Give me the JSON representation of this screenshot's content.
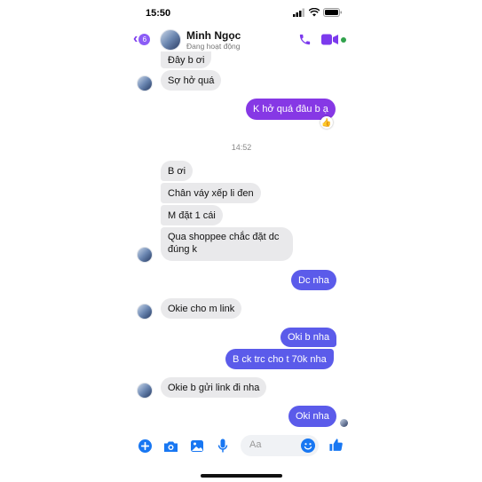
{
  "status_bar": {
    "time": "15:50"
  },
  "header": {
    "back_badge": "6",
    "contact_name": "Minh Ngọc",
    "status": "Đang hoạt động"
  },
  "messages": [
    {
      "text": "Đây b ơi",
      "sender": "contact"
    },
    {
      "text": "Sợ hở quá",
      "sender": "contact"
    },
    {
      "text": "K hở quá đâu b ạ",
      "sender": "me",
      "reaction": "like-icon"
    },
    {
      "text": "B ơi",
      "sender": "contact"
    },
    {
      "text": "Chân váy xếp li đen",
      "sender": "contact"
    },
    {
      "text": "M đặt 1 cái",
      "sender": "contact"
    },
    {
      "text": "Qua shoppee chắc đặt dc đúng k",
      "sender": "contact"
    },
    {
      "text": "Dc nha",
      "sender": "me"
    },
    {
      "text": "Okie cho m link",
      "sender": "contact"
    },
    {
      "text": "Oki b nha",
      "sender": "me"
    },
    {
      "text": "B ck trc cho t 70k nha",
      "sender": "me"
    },
    {
      "text": "Okie b gửi link đi nha",
      "sender": "contact"
    },
    {
      "text": "Oki nha",
      "sender": "me"
    }
  ],
  "timestamp": "14:52",
  "composer": {
    "placeholder": "Aa"
  },
  "colors": {
    "accent": "#7c3aed",
    "outgoing": "#5b5bea",
    "outgoing_top": "#8638e5",
    "incoming": "#e9e9eb",
    "messenger_blue": "#1877f2"
  },
  "icons": [
    "back-chevron-icon",
    "phone-icon",
    "video-camera-icon",
    "plus-icon",
    "camera-icon",
    "image-icon",
    "microphone-icon",
    "emoji-icon",
    "like-icon",
    "wifi-icon",
    "battery-icon",
    "signal-icon"
  ]
}
